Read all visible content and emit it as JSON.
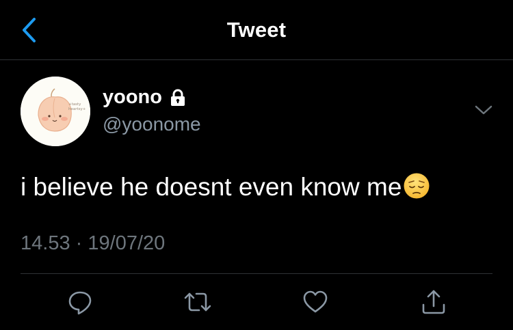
{
  "header": {
    "title": "Tweet"
  },
  "author": {
    "display_name": "yoono",
    "handle": "@yoonome",
    "protected": true,
    "avatar_caption_top": "+tasty",
    "avatar_caption_bottom": "heartsy+"
  },
  "tweet": {
    "text": "i believe he doesnt even know me",
    "emoji": "pensive-face",
    "time": "14.53",
    "separator": "·",
    "date": "19/07/20"
  },
  "actions": [
    "reply",
    "retweet",
    "like",
    "share"
  ],
  "colors": {
    "background": "#000000",
    "accent": "#1d9bf0",
    "text_primary": "#ffffff",
    "text_secondary": "#8b98a5",
    "divider": "#2f3336"
  }
}
